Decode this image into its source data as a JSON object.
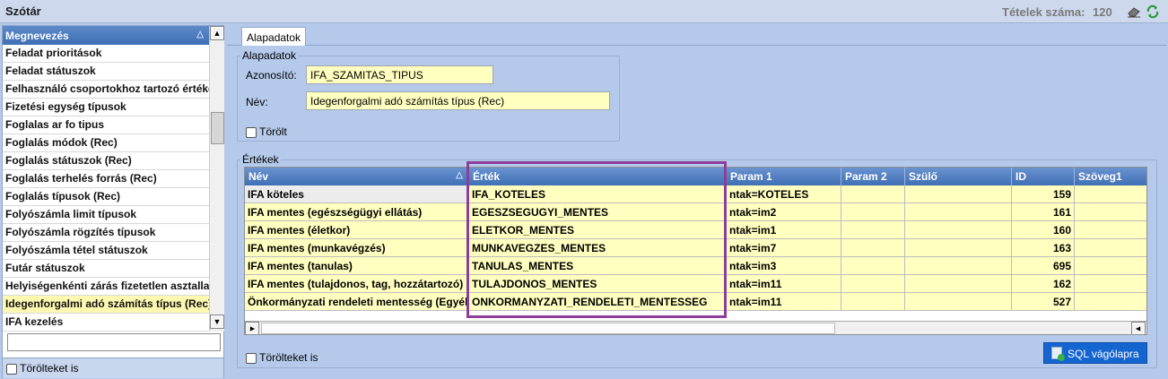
{
  "window": {
    "title": "Szótár",
    "item_count_label": "Tételek száma:",
    "item_count_value": "120",
    "icons": [
      "eraser-icon",
      "refresh-icon"
    ]
  },
  "left": {
    "header": "Megnevezés",
    "items": [
      "Feladat prioritások",
      "Feladat státuszok",
      "Felhasználó csoportokhoz tartozó értékek",
      "Fizetési egység típusok",
      "Foglalas ar fo tipus",
      "Foglalás módok (Rec)",
      "Foglalás státuszok (Rec)",
      "Foglalás terhelés forrás (Rec)",
      "Foglalás típusok (Rec)",
      "Folyószámla limit típusok",
      "Folyószámla rögzítés típusok",
      "Folyószámla tétel státuszok",
      "Futár státuszok",
      "Helyiségenkénti zárás fizetetlen asztallal",
      "Idegenforgalmi adó számítás típus (Rec)",
      "IFA kezelés"
    ],
    "search_value": "",
    "show_deleted_label": "Törölteket is"
  },
  "tab": {
    "label": "Alapadatok"
  },
  "basic": {
    "group_label": "Alapadatok",
    "id_label": "Azonosító:",
    "id_value": "IFA_SZAMITAS_TIPUS",
    "name_label": "Név:",
    "name_value": "Idegenforgalmi adó számítás típus (Rec)",
    "deleted_label": "Törölt"
  },
  "values": {
    "group_label": "Értékek",
    "columns": [
      "Név",
      "Érték",
      "Param 1",
      "Param 2",
      "Szülő",
      "ID",
      "Szöveg1"
    ],
    "rows": [
      {
        "nev": "IFA köteles",
        "ertek": "IFA_KOTELES",
        "param1": "ntak=KOTELES",
        "param2": "",
        "szulo": "",
        "id": "159",
        "szoveg1": ""
      },
      {
        "nev": "IFA mentes (egészségügyi ellátás)",
        "ertek": "EGESZSEGUGYI_MENTES",
        "param1": "ntak=im2",
        "param2": "",
        "szulo": "",
        "id": "161",
        "szoveg1": ""
      },
      {
        "nev": "IFA mentes (életkor)",
        "ertek": "ELETKOR_MENTES",
        "param1": "ntak=im1",
        "param2": "",
        "szulo": "",
        "id": "160",
        "szoveg1": ""
      },
      {
        "nev": "IFA mentes (munkavégzés)",
        "ertek": "MUNKAVEGZES_MENTES",
        "param1": "ntak=im7",
        "param2": "",
        "szulo": "",
        "id": "163",
        "szoveg1": ""
      },
      {
        "nev": "IFA mentes (tanulas)",
        "ertek": "TANULAS_MENTES",
        "param1": "ntak=im3",
        "param2": "",
        "szulo": "",
        "id": "695",
        "szoveg1": ""
      },
      {
        "nev": "IFA mentes (tulajdonos, tag, hozzátartozó)",
        "ertek": "TULAJDONOS_MENTES",
        "param1": "ntak=im11",
        "param2": "",
        "szulo": "",
        "id": "162",
        "szoveg1": ""
      },
      {
        "nev": "Önkormányzati rendeleti mentesség (Egyéb)",
        "ertek": "ONKORMANYZATI_RENDELETI_MENTESSEG",
        "param1": "ntak=im11",
        "param2": "",
        "szulo": "",
        "id": "527",
        "szoveg1": ""
      }
    ],
    "show_deleted_label": "Törölteket is",
    "sql_button_label": "SQL vágólapra"
  },
  "colors": {
    "header_blue": "#3f6fb5",
    "field_yellow": "#ffffc0",
    "highlight_purple": "#8e3d9a",
    "button_blue": "#1565d0"
  }
}
